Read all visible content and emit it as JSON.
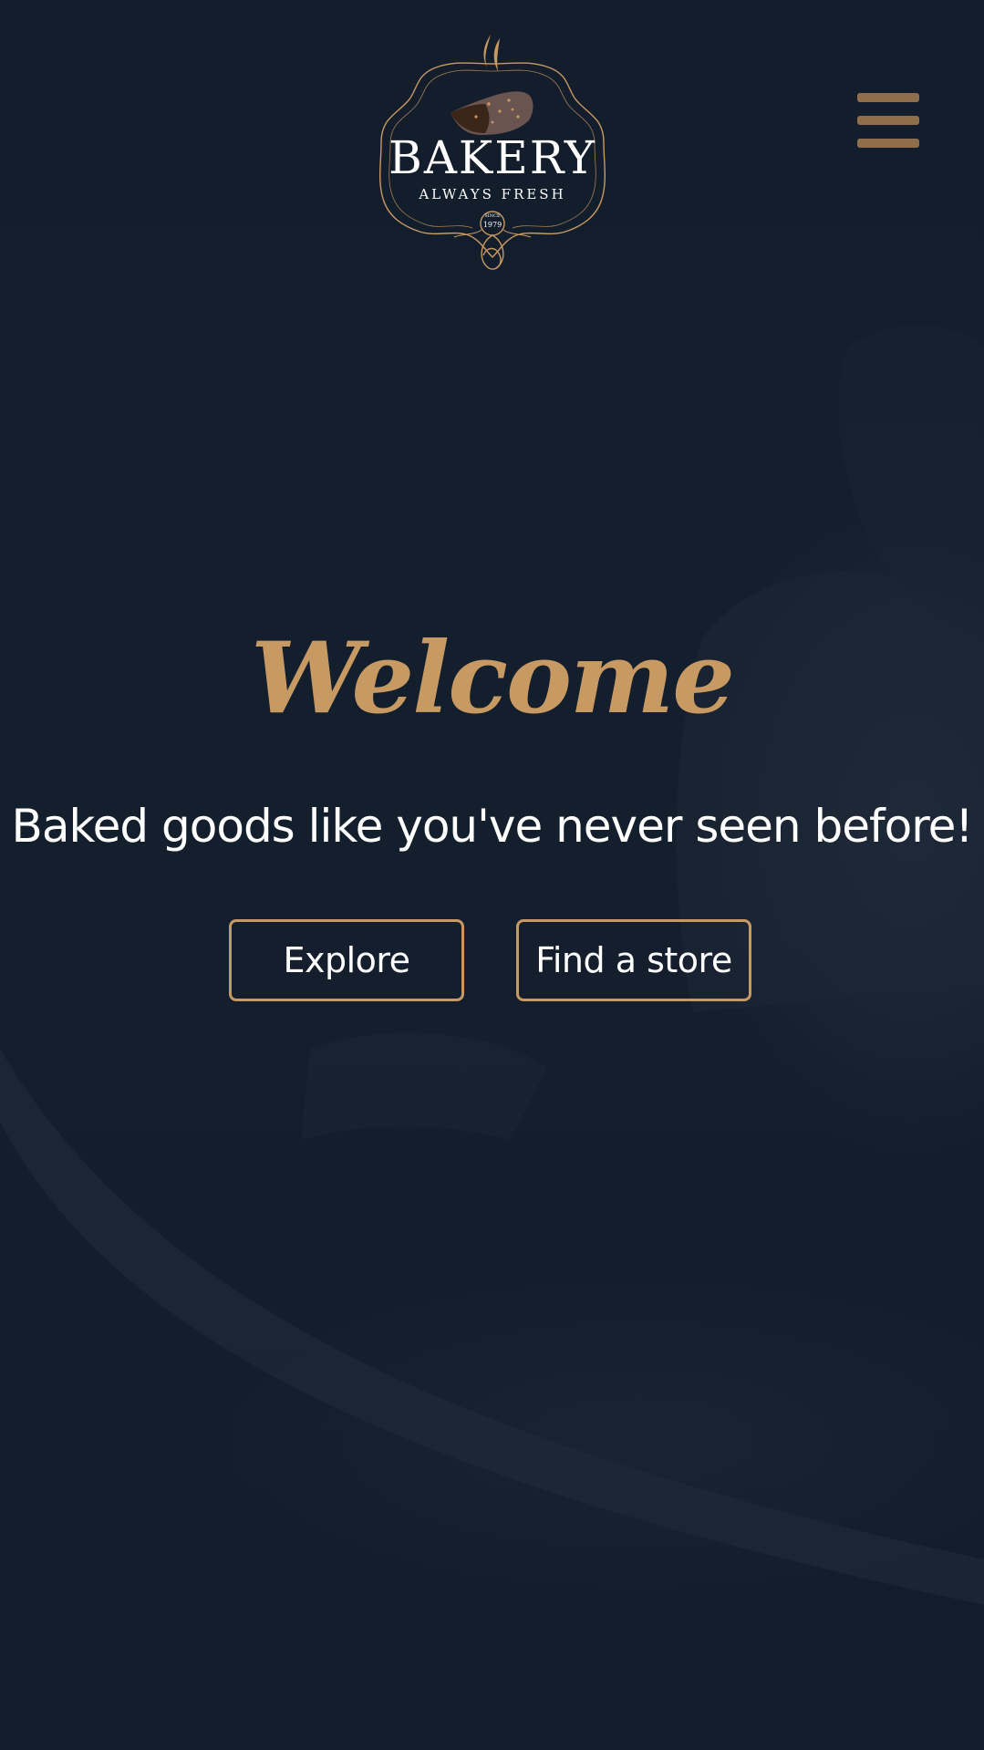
{
  "brand": {
    "name": "BAKERY",
    "tagline": "ALWAYS FRESH",
    "since_label": "SINCE",
    "since_year": "1979"
  },
  "header": {
    "menu_icon": "hamburger-menu-icon"
  },
  "hero": {
    "title": "Welcome",
    "subtitle": "Baked goods like you've never seen before!",
    "buttons": {
      "explore": "Explore",
      "find_store": "Find a store"
    }
  },
  "colors": {
    "background": "#121d2b",
    "accent_gold": "#c89a63",
    "menu_icon": "#8f6f4b",
    "text_white": "#ffffff"
  }
}
